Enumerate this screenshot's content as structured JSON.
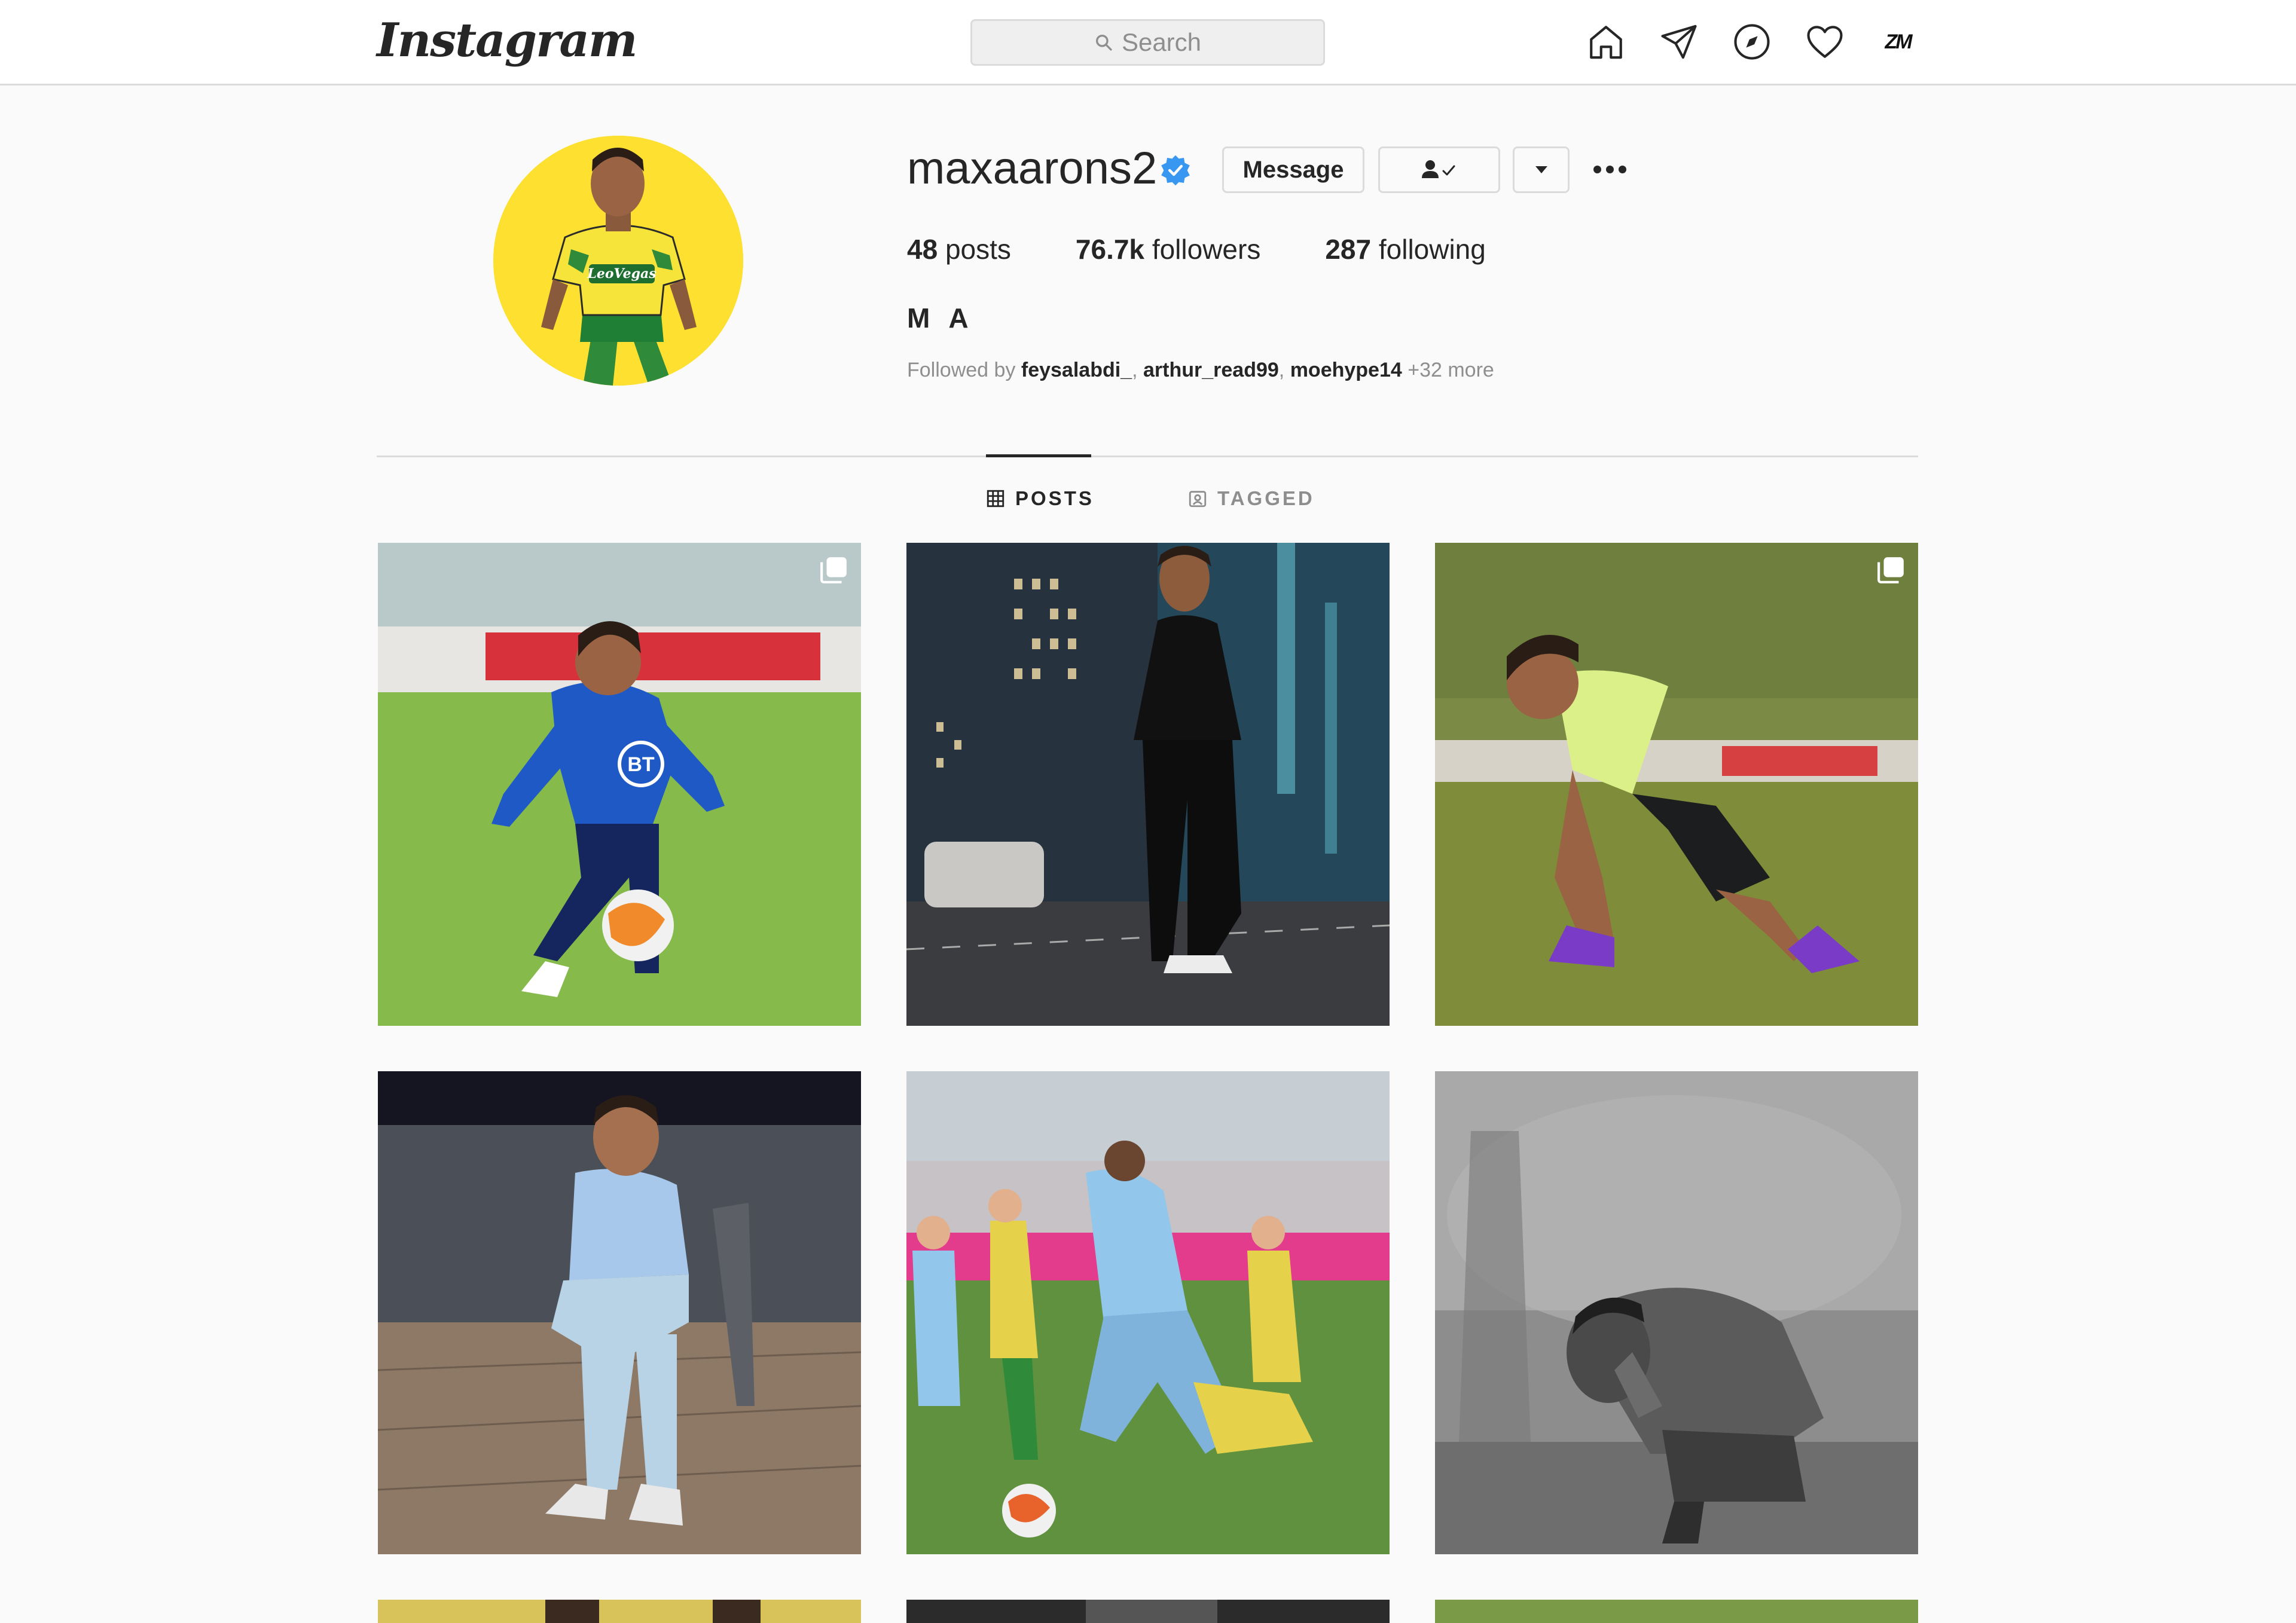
{
  "header": {
    "logo": "Instagram",
    "search_placeholder": "Search",
    "nav": [
      "home-icon",
      "direct-icon",
      "explore-icon",
      "activity-icon",
      "profile-avatar"
    ],
    "avatar_label": "ZM"
  },
  "profile": {
    "username": "maxaarons2",
    "verified": true,
    "message_label": "Message",
    "stats": {
      "posts_count": "48",
      "posts_label": "posts",
      "followers_count": "76.7k",
      "followers_label": "followers",
      "following_count": "287",
      "following_label": "following"
    },
    "full_name": "M A",
    "followed_by": {
      "prefix": "Followed by",
      "users": [
        "feysalabdi_",
        "arthur_read99",
        "moehype14"
      ],
      "more": "+32 more"
    }
  },
  "tabs": [
    {
      "label": "POSTS",
      "active": true
    },
    {
      "label": "TAGGED",
      "active": false
    }
  ],
  "posts": [
    {
      "desc": "training in blue kit with ball",
      "multi": true
    },
    {
      "desc": "city street at night",
      "multi": false
    },
    {
      "desc": "tying boots on grass",
      "multi": true
    },
    {
      "desc": "sitting on chair",
      "multi": false
    },
    {
      "desc": "match action",
      "multi": false
    },
    {
      "desc": "black and white crouching",
      "multi": false
    }
  ],
  "colors": {
    "brand_accent": "#3897f0",
    "text_primary": "#262626",
    "text_secondary": "#8e8e8e",
    "border": "#dbdbdb",
    "profile_bg": "#fde030"
  }
}
